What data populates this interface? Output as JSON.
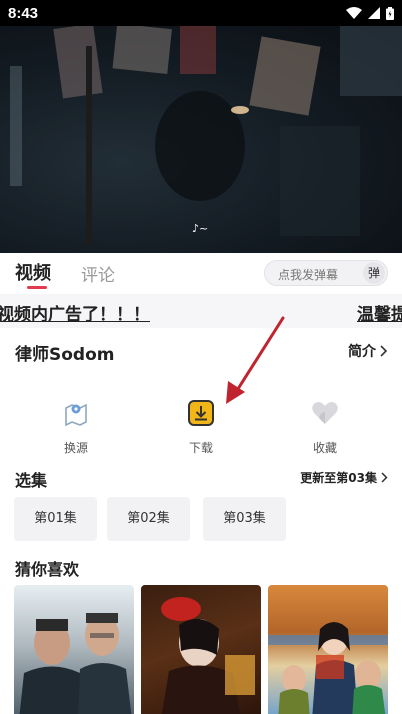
{
  "status": {
    "time": "8:43"
  },
  "video": {
    "caption": "♪~"
  },
  "tabs": {
    "video": "视频",
    "comment": "评论"
  },
  "danmaku": {
    "placeholder": "点我发弹幕",
    "button": "弹"
  },
  "marquee": {
    "text1": "视频内广告了！！！",
    "text2": "温馨提"
  },
  "show": {
    "title": "律师Sodom",
    "intro_label": "简介"
  },
  "actions": {
    "source": "换源",
    "download": "下载",
    "collect": "收藏"
  },
  "episodes": {
    "title": "选集",
    "update": "更新至第03集",
    "items": [
      "第01集",
      "第02集",
      "第03集"
    ]
  },
  "recommend": {
    "title": "猜你喜欢"
  },
  "colors": {
    "accent": "#e33b4e",
    "download_icon": "#f2b619",
    "arrow": "#c0242f"
  }
}
